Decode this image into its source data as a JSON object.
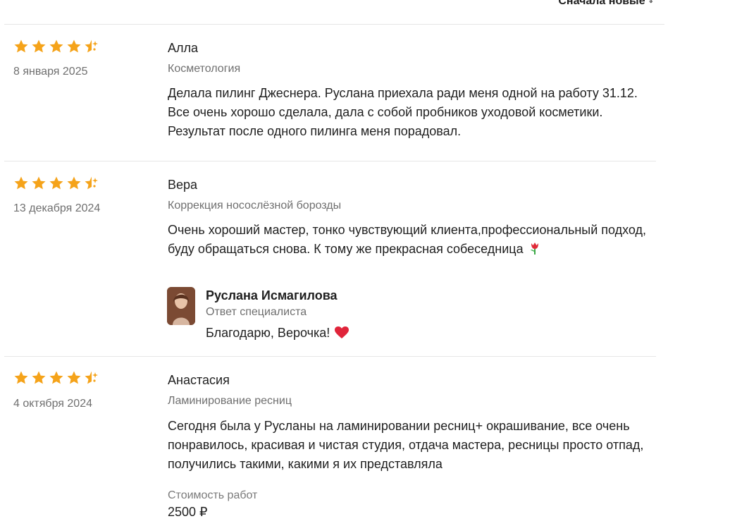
{
  "sort": {
    "label": "Сначала новые",
    "icon": "sort-chevrons-icon"
  },
  "colors": {
    "star": "#f5a31a",
    "muted": "#6f6f6f",
    "divider": "#e6e6e6"
  },
  "reviews": [
    {
      "rating": 4.5,
      "date": "8 января 2025",
      "name": "Алла",
      "service": "Косметология",
      "text": "Делала пилинг Джеснера. Руслана приехала ради меня одной на работу 31.12. Все очень хорошо сделала, дала с собой пробников уходовой косметики. Результат после одного пилинга меня порадовал."
    },
    {
      "rating": 4.5,
      "date": "13 декабря 2024",
      "name": "Вера",
      "service": "Коррекция носослёзной борозды",
      "text": "Очень хороший мастер, тонко чувствующий клиента,профессиональный подход, буду обращаться снова. К тому же прекрасная собеседница",
      "reply": {
        "name": "Руслана Исмагилова",
        "role": "Ответ специалиста",
        "text": "Благодарю, Верочка!"
      }
    },
    {
      "rating": 4.5,
      "date": "4 октября 2024",
      "name": "Анастасия",
      "service": "Ламинирование ресниц",
      "text": "Сегодня была у Русланы на ламинировании ресниц+ окрашивание, все очень понравилось, красивая и чистая студия, отдача мастера, ресницы просто отпад, получились такими, какими я их представляла",
      "cost_label": "Стоимость работ",
      "cost_value": "2500 ₽"
    }
  ]
}
